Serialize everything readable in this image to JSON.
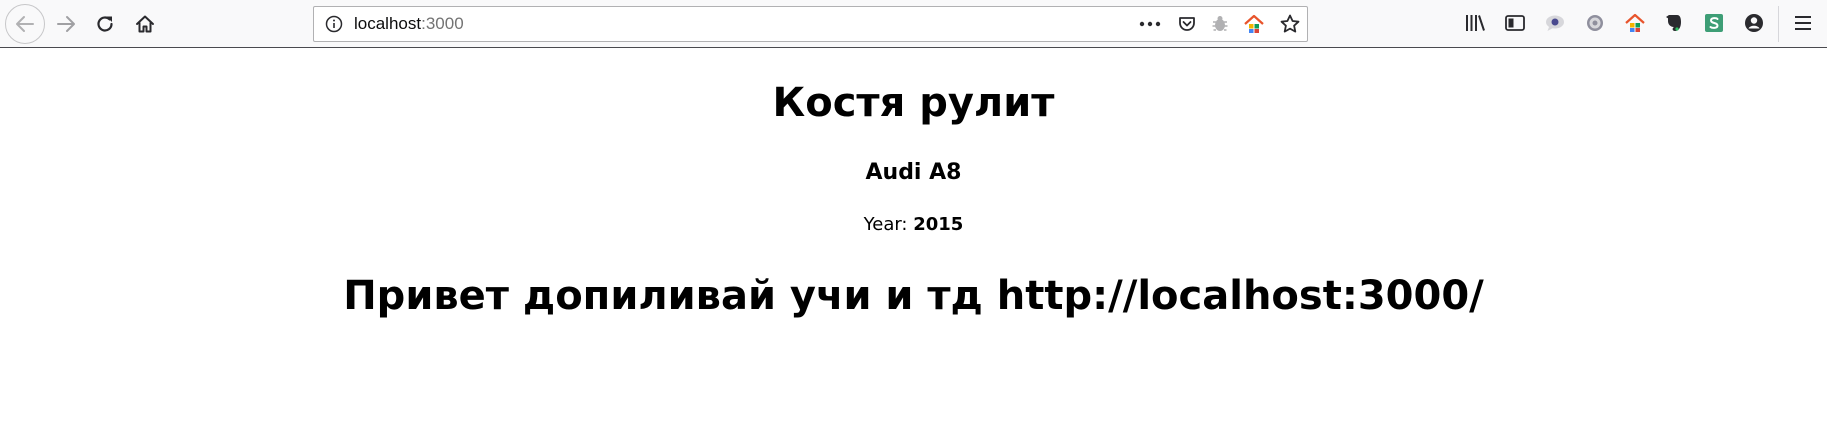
{
  "browser": {
    "url_host": "localhost",
    "url_port": ":3000",
    "icons": {
      "back": "back-arrow-icon",
      "forward": "forward-arrow-icon",
      "reload": "reload-icon",
      "home": "home-icon",
      "info": "info-icon",
      "more": "more-dots-icon",
      "pocket": "pocket-icon",
      "bug": "bug-icon",
      "house_ext": "colorful-house-icon",
      "star": "star-icon",
      "library": "library-icon",
      "sidebar": "sidebar-icon",
      "ext1": "speech-bubble-icon",
      "ext2": "gear-icon",
      "ext3": "colorful-house-icon",
      "ext4": "evernote-icon",
      "ext5": "s-extension-icon",
      "account": "account-icon",
      "menu": "hamburger-menu-icon"
    }
  },
  "page": {
    "title": "Костя рулит",
    "car_name": "Audi A8",
    "year_label": "Year: ",
    "year_value": "2015",
    "greeting": "Привет допиливай учи и тд http://localhost:3000/"
  }
}
